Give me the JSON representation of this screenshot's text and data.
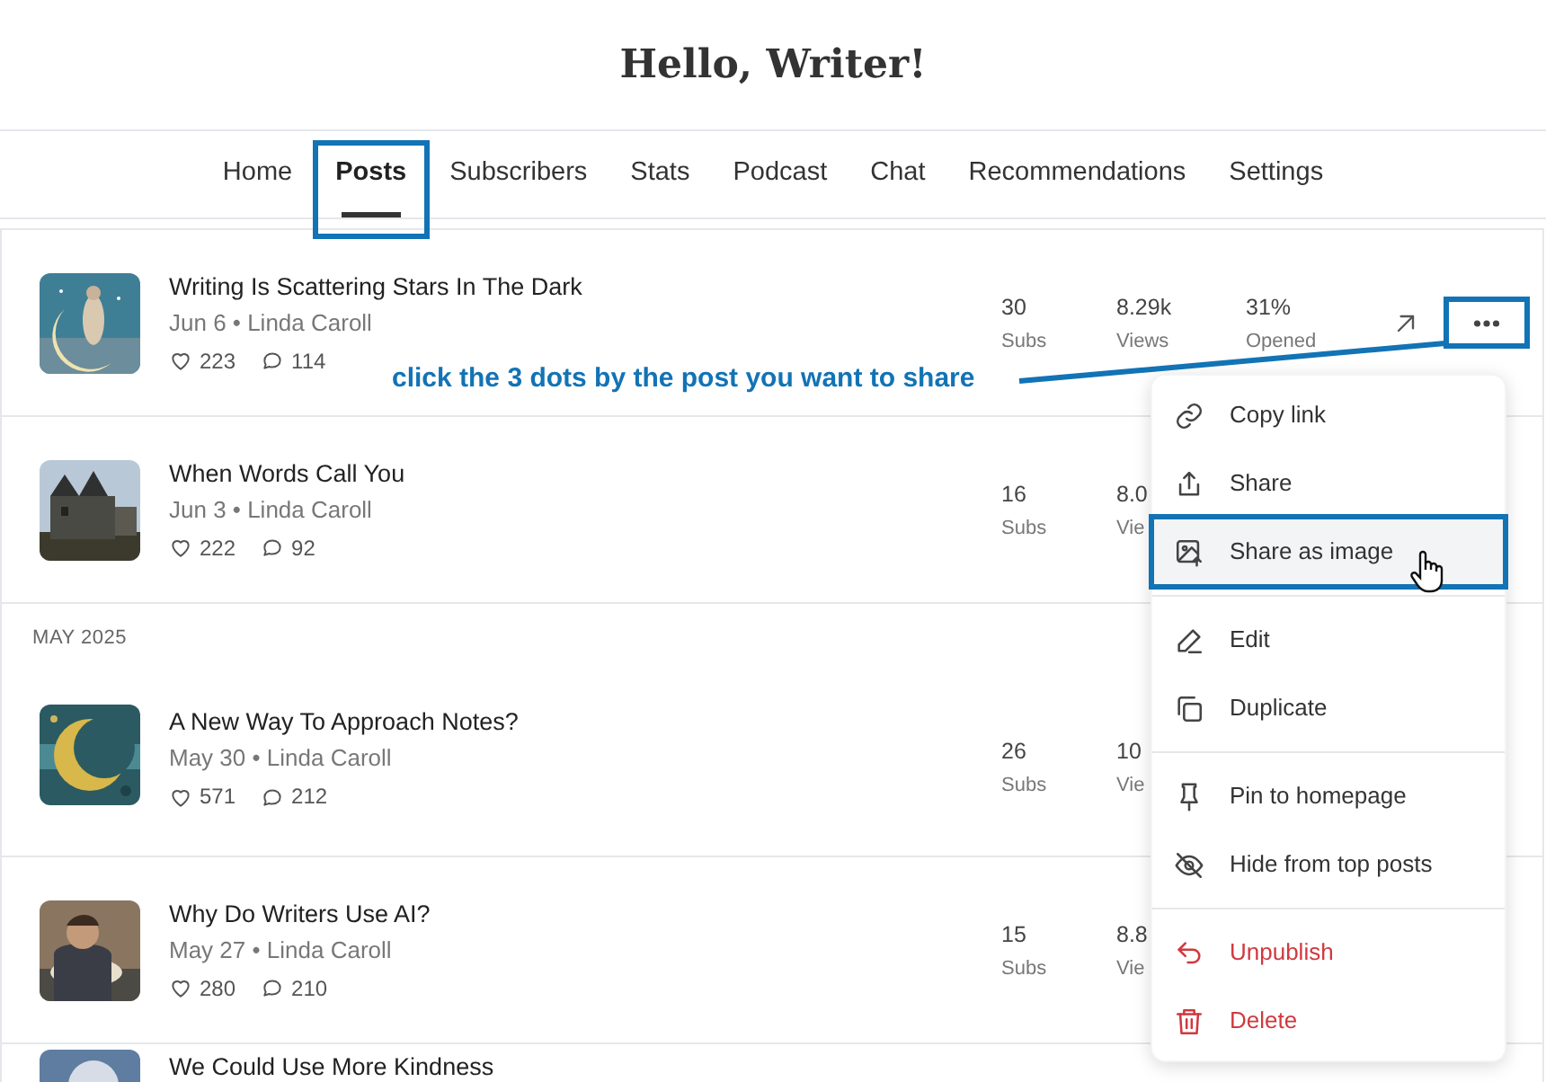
{
  "header": {
    "title": "Hello, Writer!"
  },
  "tabs": [
    {
      "label": "Home",
      "selected": false,
      "highlighted": false
    },
    {
      "label": "Posts",
      "selected": true,
      "highlighted": true
    },
    {
      "label": "Subscribers",
      "selected": false,
      "highlighted": false
    },
    {
      "label": "Stats",
      "selected": false,
      "highlighted": false
    },
    {
      "label": "Podcast",
      "selected": false,
      "highlighted": false
    },
    {
      "label": "Chat",
      "selected": false,
      "highlighted": false
    },
    {
      "label": "Recommendations",
      "selected": false,
      "highlighted": false
    },
    {
      "label": "Settings",
      "selected": false,
      "highlighted": false
    }
  ],
  "sections": [
    {
      "posts": [
        {
          "title": "Writing Is Scattering Stars In The Dark",
          "meta": "Jun 6 • Linda Caroll",
          "likes": "223",
          "comments": "114",
          "stats": [
            {
              "value": "30",
              "label": "Subs"
            },
            {
              "value": "8.29k",
              "label": "Views"
            },
            {
              "value": "31%",
              "label": "Opened"
            }
          ],
          "actions": {
            "highlighted": true
          }
        },
        {
          "title": "When Words Call You",
          "meta": "Jun 3 • Linda Caroll",
          "likes": "222",
          "comments": "92",
          "stats": [
            {
              "value": "16",
              "label": "Subs"
            },
            {
              "value": "8.0",
              "label": "Vie"
            }
          ]
        }
      ]
    },
    {
      "label": "MAY 2025",
      "posts": [
        {
          "title": "A New Way To Approach Notes?",
          "meta": "May 30 • Linda Caroll",
          "likes": "571",
          "comments": "212",
          "stats": [
            {
              "value": "26",
              "label": "Subs"
            },
            {
              "value": "10",
              "label": "Vie"
            }
          ]
        },
        {
          "title": "Why Do Writers Use AI?",
          "meta": "May 27 • Linda Caroll",
          "likes": "280",
          "comments": "210",
          "stats": [
            {
              "value": "15",
              "label": "Subs"
            },
            {
              "value": "8.8",
              "label": "Vie"
            }
          ]
        },
        {
          "title": "We Could Use More Kindness"
        }
      ]
    }
  ],
  "menu": {
    "groups": [
      [
        {
          "label": "Copy link",
          "kind": "normal",
          "highlighted": false
        },
        {
          "label": "Share",
          "kind": "normal",
          "highlighted": false
        },
        {
          "label": "Share as image",
          "kind": "normal",
          "highlighted": true
        }
      ],
      [
        {
          "label": "Edit",
          "kind": "normal",
          "highlighted": false
        },
        {
          "label": "Duplicate",
          "kind": "normal",
          "highlighted": false
        }
      ],
      [
        {
          "label": "Pin to homepage",
          "kind": "normal",
          "highlighted": false
        },
        {
          "label": "Hide from top posts",
          "kind": "normal",
          "highlighted": false
        }
      ],
      [
        {
          "label": "Unpublish",
          "kind": "danger",
          "highlighted": false
        },
        {
          "label": "Delete",
          "kind": "danger",
          "highlighted": false
        }
      ]
    ]
  },
  "annotation": {
    "text": "click the 3 dots by the post you want to share"
  }
}
